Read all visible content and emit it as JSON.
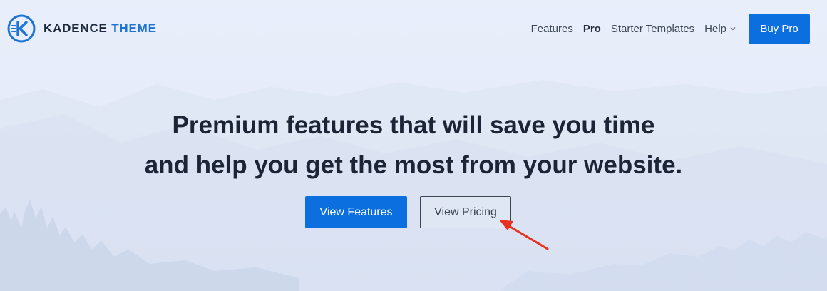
{
  "brand": {
    "name_part1": "KADENCE",
    "name_part2": "THEME",
    "logo_icon": "kadence-logo-icon",
    "accent_color": "#1e73d6"
  },
  "nav": {
    "items": [
      {
        "label": "Features"
      },
      {
        "label": "Pro"
      },
      {
        "label": "Starter Templates"
      },
      {
        "label": "Help"
      }
    ],
    "buy_label": "Buy Pro"
  },
  "hero": {
    "title_line1": "Premium features that will save you time",
    "title_line2": "and help you get the most from your website.",
    "primary_button": "View Features",
    "secondary_button": "View Pricing"
  },
  "colors": {
    "primary": "#0b6fdf",
    "text_dark": "#1b2535",
    "annotation_arrow": "#e8311f"
  }
}
